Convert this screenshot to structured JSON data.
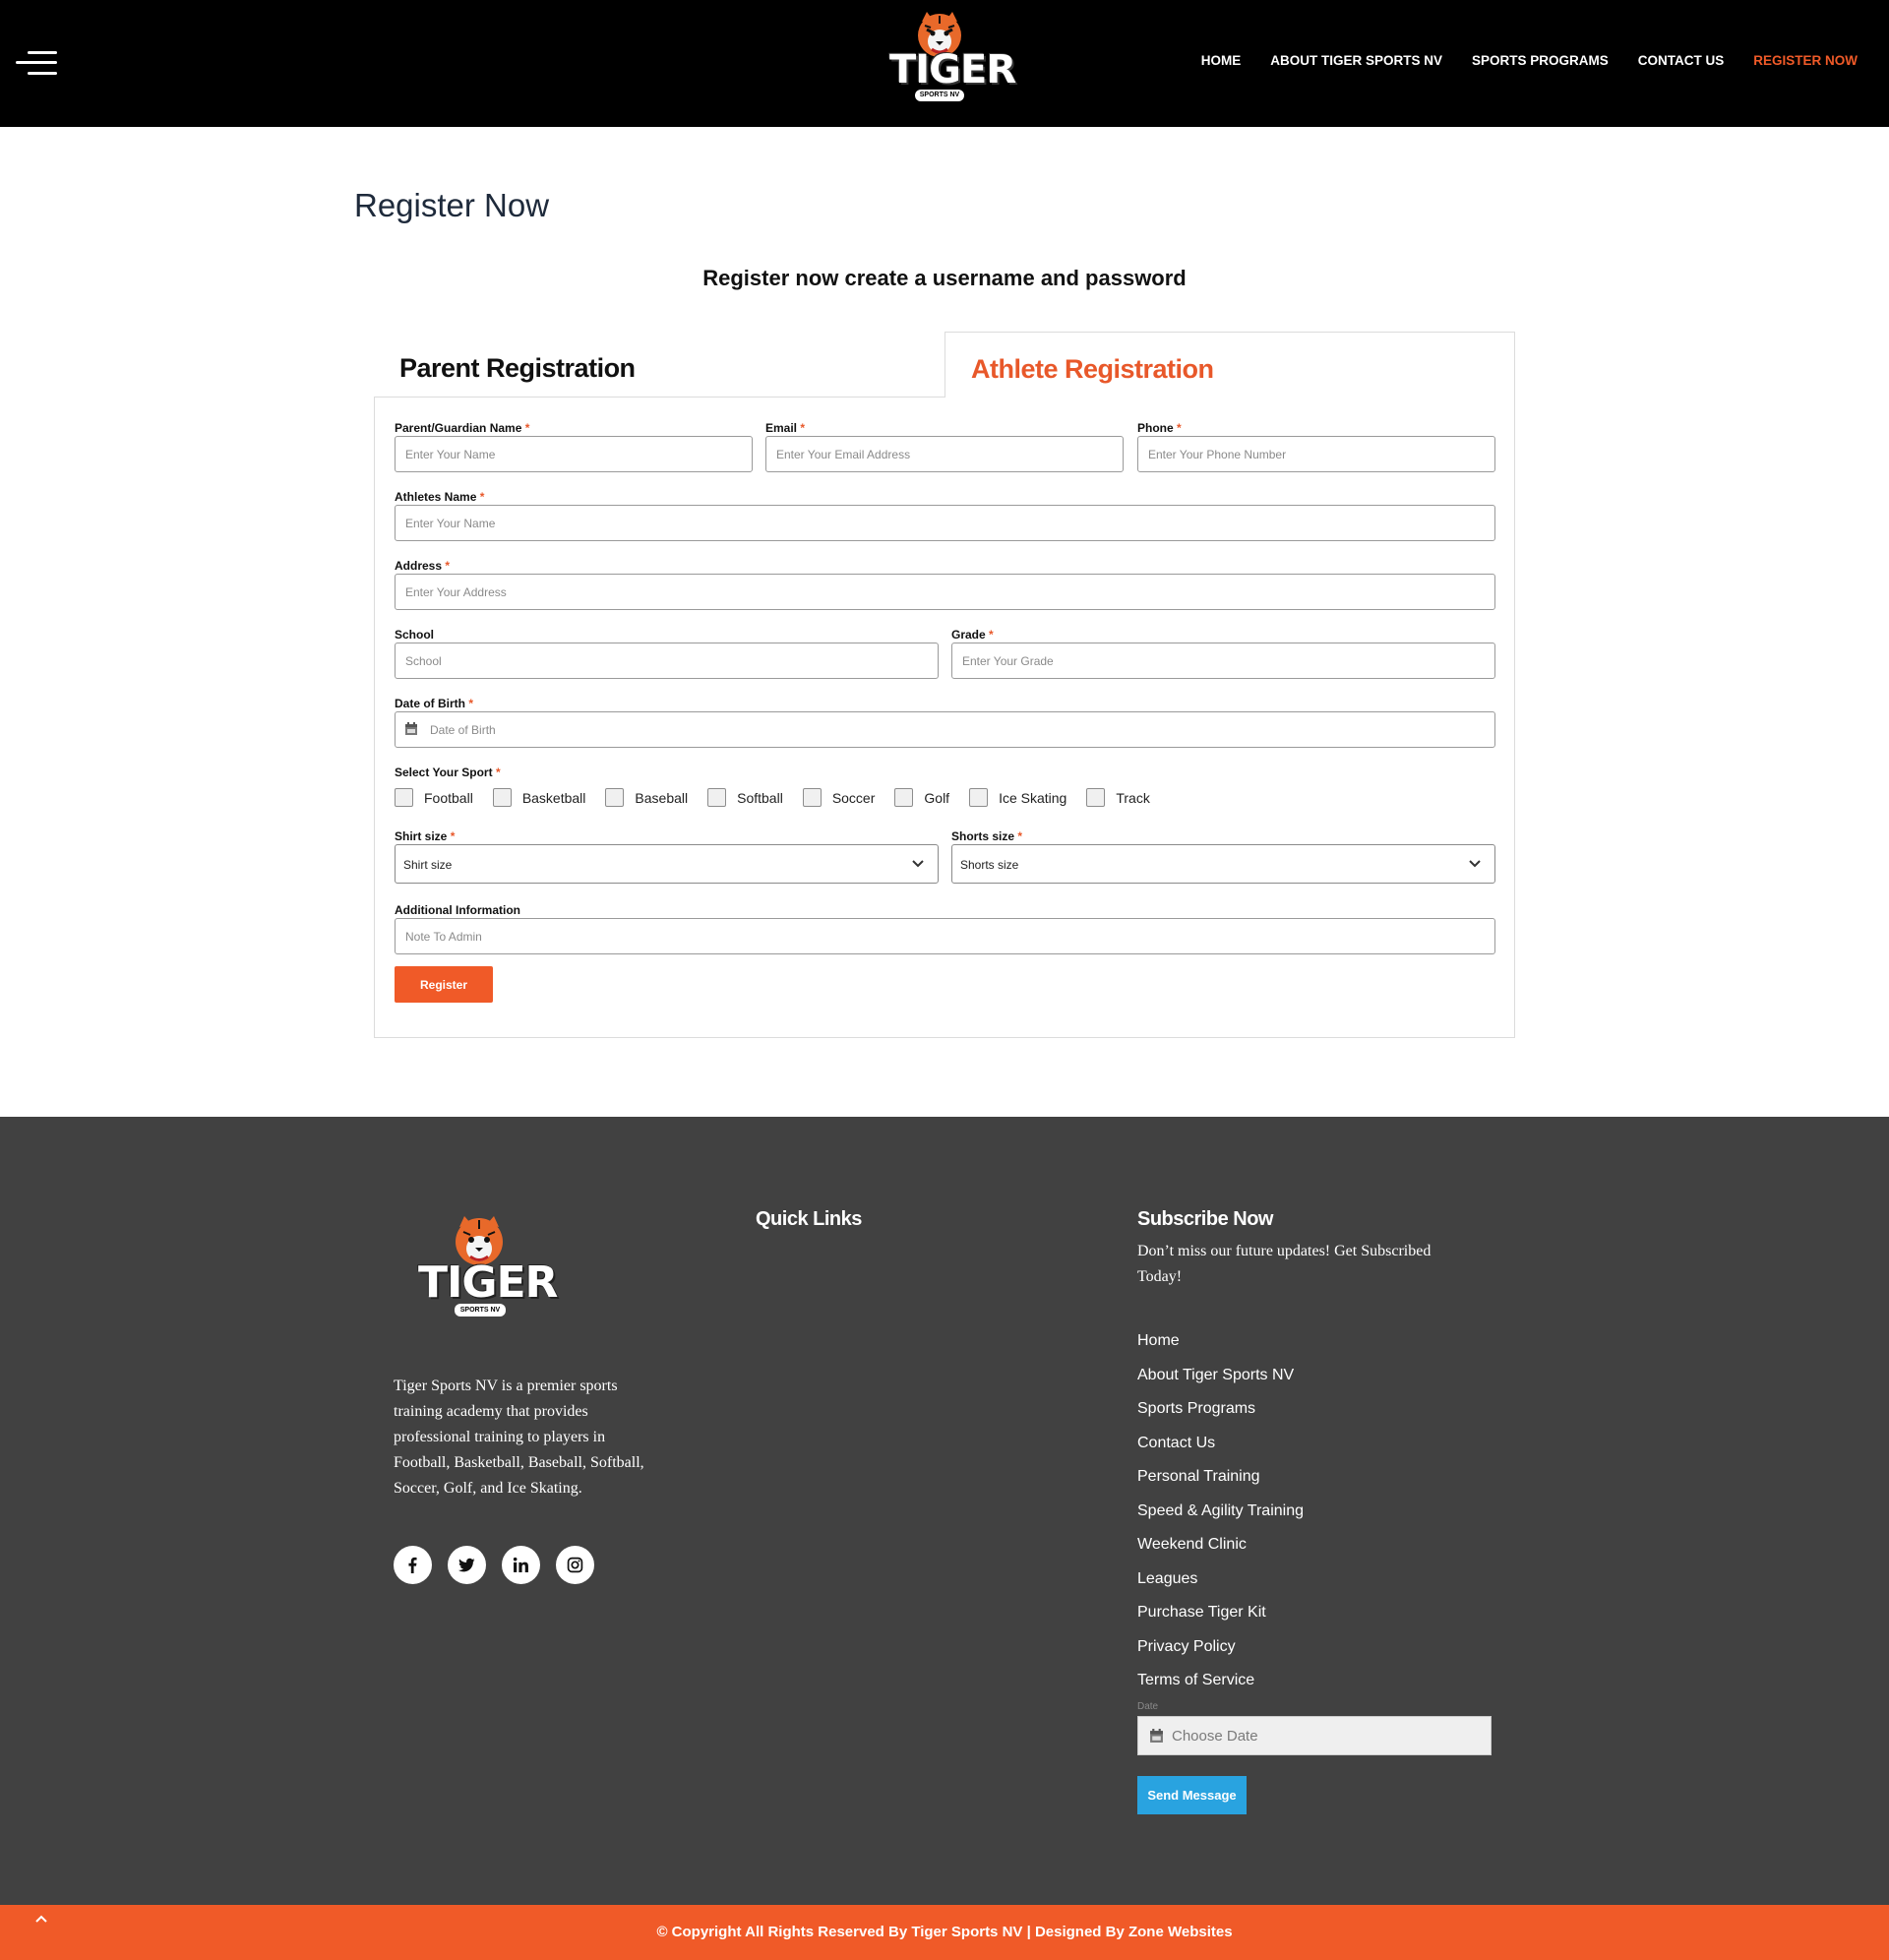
{
  "header": {
    "logo_text": "TIGER",
    "logo_sub": "SPORTS NV",
    "nav": [
      {
        "label": "HOME"
      },
      {
        "label": "ABOUT TIGER SPORTS NV"
      },
      {
        "label": "SPORTS PROGRAMS"
      },
      {
        "label": "CONTACT US"
      },
      {
        "label": "REGISTER NOW"
      }
    ],
    "active_color": "#f05a28"
  },
  "page": {
    "title": "Register Now",
    "subtitle": "Register now create a username and password"
  },
  "tabs": {
    "parent": "Parent Registration",
    "athlete": "Athlete Registration"
  },
  "form": {
    "parent_name": {
      "label": "Parent/Guardian Name",
      "placeholder": "Enter Your Name"
    },
    "email": {
      "label": "Email",
      "placeholder": "Enter Your Email Address"
    },
    "phone": {
      "label": "Phone",
      "placeholder": "Enter Your Phone Number"
    },
    "athlete_name": {
      "label": "Athletes Name",
      "placeholder": "Enter Your Name"
    },
    "address": {
      "label": "Address",
      "placeholder": "Enter Your Address"
    },
    "school": {
      "label": "School",
      "placeholder": "School"
    },
    "grade": {
      "label": "Grade",
      "placeholder": "Enter Your Grade"
    },
    "dob": {
      "label": "Date of Birth",
      "placeholder": "Date of Birth"
    },
    "sport": {
      "label": "Select Your Sport",
      "options": [
        "Football",
        "Basketball",
        "Baseball",
        "Softball",
        "Soccer",
        "Golf",
        "Ice Skating",
        "Track"
      ]
    },
    "shirt": {
      "label": "Shirt size",
      "value": "Shirt size"
    },
    "shorts": {
      "label": "Shorts size",
      "value": "Shorts size"
    },
    "additional": {
      "label": "Additional Information",
      "placeholder": "Note To Admin"
    },
    "required_mark": "*",
    "submit": "Register"
  },
  "footer": {
    "logo_text": "TIGER",
    "logo_sub": "SPORTS NV",
    "about": "Tiger Sports NV is a premier sports training academy that provides professional training to players in Football, Basketball, Baseball, Softball, Soccer, Golf, and Ice Skating.",
    "socials": [
      "facebook-icon",
      "twitter-icon",
      "linkedin-icon",
      "instagram-icon"
    ],
    "quick_links_title": "Quick Links",
    "subscribe_title": "Subscribe Now",
    "subscribe_text": "Don’t miss our future updates! Get Subscribed Today!",
    "links": [
      "Home",
      "About Tiger Sports NV",
      "Sports Programs",
      "Contact Us",
      "Personal Training",
      "Speed & Agility Training",
      "Weekend Clinic",
      "Leagues",
      "Purchase Tiger Kit",
      "Privacy Policy",
      "Terms of Service"
    ],
    "date_label": "Date",
    "date_placeholder": "Choose Date",
    "send_label": "Send Message",
    "send_color": "#29a3e0",
    "copyright": "© Copyright All Rights Reserved By Tiger Sports NV | Designed By Zone Websites"
  }
}
